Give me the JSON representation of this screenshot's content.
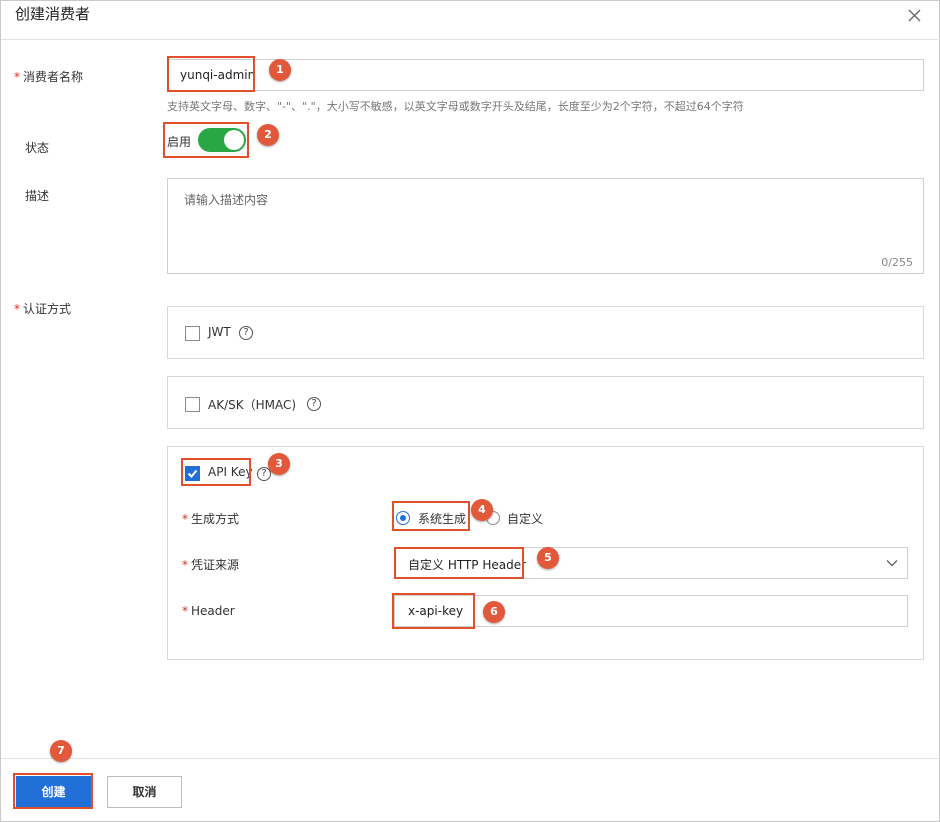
{
  "dialog": {
    "title": "创建消费者",
    "close_icon": "close-icon"
  },
  "form": {
    "name": {
      "required_mark": "*",
      "label": "消费者名称",
      "value": "yunqi-admin",
      "hint": "支持英文字母、数字、\"-\"、\".\"，大小写不敏感，以英文字母或数字开头及结尾，长度至少为2个字符，不超过64个字符"
    },
    "status": {
      "label": "状态",
      "toggle_label": "启用",
      "enabled": true
    },
    "description": {
      "label": "描述",
      "placeholder": "请输入描述内容",
      "counter": "0/255"
    },
    "auth": {
      "required_mark": "*",
      "label": "认证方式",
      "options": [
        {
          "label": "JWT",
          "checked": false,
          "help_icon": "?"
        },
        {
          "label": "AK/SK（HMAC)",
          "checked": false,
          "help_icon": "?"
        },
        {
          "label": "API Key",
          "checked": true,
          "help_icon": "?"
        }
      ],
      "api_key": {
        "gen_method": {
          "required_mark": "*",
          "label": "生成方式",
          "options": [
            "系统生成",
            "自定义"
          ],
          "selected": "系统生成"
        },
        "source": {
          "required_mark": "*",
          "label": "凭证来源",
          "value": "自定义 HTTP Header"
        },
        "header": {
          "required_mark": "*",
          "label": "Header",
          "value": "x-api-key"
        }
      }
    }
  },
  "footer": {
    "create_label": "创建",
    "cancel_label": "取消"
  },
  "annotations": [
    "1",
    "2",
    "3",
    "4",
    "5",
    "6",
    "7"
  ],
  "colors": {
    "primary": "#1f6fd6",
    "toggle_on": "#27a844",
    "annotation": "#e2583a",
    "required": "#d93026"
  }
}
